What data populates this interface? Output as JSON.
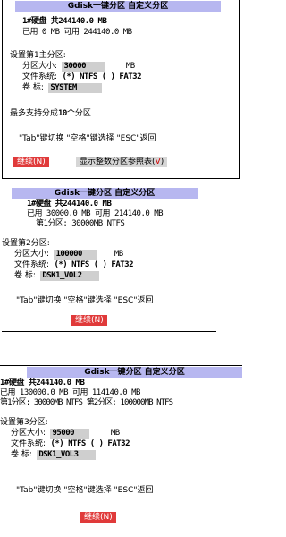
{
  "panel1": {
    "title": "Gdisk一键分区  自定义分区",
    "disk_line": "1#硬盘 共244140.0 MB",
    "used_line": "已用 0 MB  可用 244140.0 MB",
    "setup_heading": "设置第1主分区:",
    "size_label": "分区大小:",
    "size_value": "30000",
    "size_unit": "MB",
    "fs_label": "文件系统:",
    "fs_options": "(*) NTFS ( ) FAT32",
    "vol_label": "卷   标:",
    "vol_value": "SYSTEM",
    "max_line_pre": "最多支持分成",
    "max_line_num": "10",
    "max_line_post": "个分区",
    "help_line": "\"Tab\"键切换 \"空格\"键选择 \"ESC\"返回",
    "continue_button": "继续(N)",
    "show_table_button_pre": "显示整数分区参照表(",
    "show_table_button_key": "V",
    "show_table_button_post": ")"
  },
  "panel2": {
    "title": "Gdisk一键分区  自定义分区",
    "disk_line": "1#硬盘 共244140.0 MB",
    "used_line": "已用 30000.0 MB  可用 214140.0 MB",
    "part1_line": "第1分区: 30000MB NTFS",
    "setup_heading": "设置第2分区:",
    "size_label": "分区大小:",
    "size_value": "100000",
    "size_unit": "MB",
    "fs_label": "文件系统:",
    "fs_options": "(*) NTFS ( ) FAT32",
    "vol_label": "卷   标:",
    "vol_value": "DSK1_VOL2",
    "help_line": "\"Tab\"键切换 \"空格\"键选择 \"ESC\"返回",
    "continue_button": "继续(N)"
  },
  "panel3": {
    "title": "Gdisk一键分区  自定义分区",
    "disk_line": "1#硬盘 共244140.0 MB",
    "used_line": "已用 130000.0 MB  可用 114140.0 MB",
    "part_line": "第1分区: 30000MB NTFS  第2分区: 100000MB NTFS",
    "setup_heading": "设置第3分区:",
    "size_label": "分区大小:",
    "size_value": "95000",
    "size_unit": "MB",
    "fs_label": "文件系统:",
    "fs_options": "(*) NTFS ( ) FAT32",
    "vol_label": "卷   标:",
    "vol_value": "DSK1_VOL3",
    "help_line": "\"Tab\"键切换 \"空格\"键选择 \"ESC\"返回",
    "continue_button": "继续(N)"
  },
  "colors": {
    "title_bar": "#b7b7f0",
    "button_red": "#e03a3a",
    "field_gray": "#cfcfcf"
  }
}
